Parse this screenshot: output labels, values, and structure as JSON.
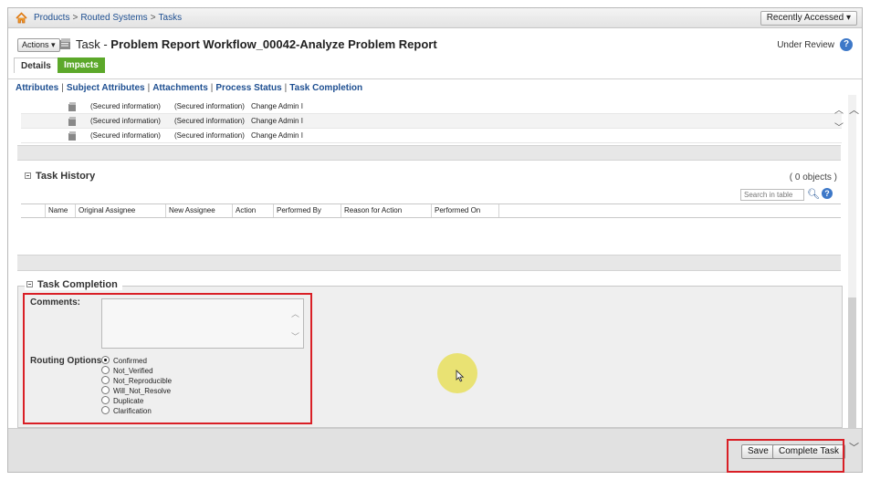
{
  "breadcrumb": {
    "items": [
      "Products",
      "Routed Systems",
      "Tasks"
    ],
    "separator": ">"
  },
  "recently_accessed": {
    "label": "Recently Accessed",
    "caret": "▾"
  },
  "header": {
    "actions_label": "Actions",
    "actions_caret": "▾",
    "title_prefix": "Task - ",
    "title_bold": "Problem Report Workflow_00042-Analyze Problem Report",
    "status": "Under Review",
    "help": "?"
  },
  "tabs": [
    {
      "label": "Details",
      "active": true
    },
    {
      "label": "Impacts",
      "active": false
    }
  ],
  "subnav": {
    "links": [
      "Attributes",
      "Subject Attributes",
      "Attachments",
      "Process Status",
      "Task Completion"
    ]
  },
  "attributes_rows": [
    {
      "col1": "(Secured information)",
      "col2": "(Secured information)",
      "col3": "Change Admin I"
    },
    {
      "col1": "(Secured information)",
      "col2": "(Secured information)",
      "col3": "Change Admin I"
    },
    {
      "col1": "(Secured information)",
      "col2": "(Secured information)",
      "col3": "Change Admin I"
    }
  ],
  "task_history": {
    "title": "Task History",
    "count": "( 0 objects )",
    "search_placeholder": "Search in table",
    "help": "?",
    "columns": [
      "Name",
      "Original Assignee",
      "New Assignee",
      "Action",
      "Performed By",
      "Reason for Action",
      "Performed On"
    ]
  },
  "task_completion": {
    "title": "Task Completion",
    "comments_label": "Comments:",
    "comments_value": "",
    "routing_label": "Routing Options:",
    "routing_options": [
      "Confirmed",
      "Not_Verified",
      "Not_Reproducible",
      "Will_Not_Resolve",
      "Duplicate",
      "Clarification"
    ],
    "selected": "Confirmed"
  },
  "footer": {
    "save_label": "Save",
    "complete_label": "Complete Task"
  },
  "colors": {
    "link": "#1e4f91",
    "tab_active_green": "#5ca82a",
    "highlight_red": "#d91f26",
    "cursor_highlight": "#e8df5d"
  }
}
